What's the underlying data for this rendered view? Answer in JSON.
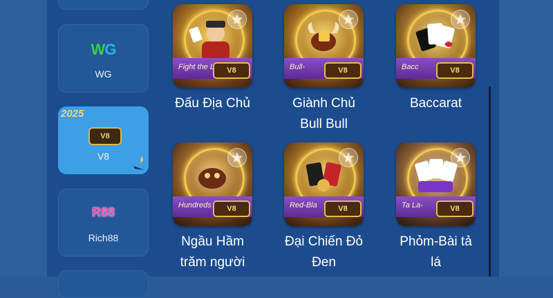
{
  "providers": [
    {
      "label": "WG",
      "logo": "WG"
    },
    {
      "label": "V8",
      "logo": "V8",
      "year": "2025"
    },
    {
      "label": "Rich88",
      "logo": "R88"
    }
  ],
  "games": [
    {
      "name": "Đấu Địa Chủ",
      "band_text": "Fight the Lan",
      "badge": "V8"
    },
    {
      "name": "Giành Chủ Bull Bull",
      "band_text": "Bull-",
      "badge": "V8"
    },
    {
      "name": "Baccarat",
      "band_text": "Bacc",
      "badge": "V8"
    },
    {
      "name": "Ngầu Hầm trăm người",
      "band_text": "Hundreds of B",
      "badge": "V8"
    },
    {
      "name": "Đại Chiến Đỏ Đen",
      "band_text": "Red-Bla",
      "badge": "V8"
    },
    {
      "name": "Phỏm-Bài tả lá",
      "band_text": "Ta La-",
      "badge": "V8"
    }
  ],
  "colors": {
    "panel": "#1d4c8e",
    "active_provider": "#3d9fe6",
    "band": "#8a4fc4",
    "gold": "#f2c84b"
  },
  "icons": [
    "favorite-star-icon"
  ]
}
